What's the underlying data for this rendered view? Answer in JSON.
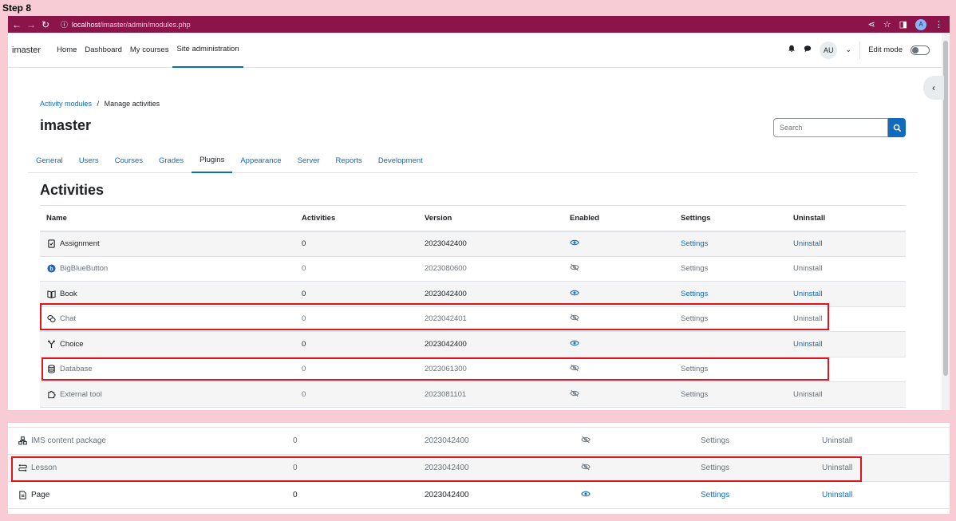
{
  "step_label": "Step 8",
  "browser": {
    "url_host": "localhost",
    "url_path": "/imaster/admin/modules.php",
    "profile_initial": "A"
  },
  "navbar": {
    "brand": "imaster",
    "links": [
      "Home",
      "Dashboard",
      "My courses",
      "Site administration"
    ],
    "user_initials": "AU",
    "edit_mode_label": "Edit mode"
  },
  "breadcrumb": {
    "link": "Activity modules",
    "separator": "/",
    "current": "Manage activities"
  },
  "page_title": "imaster",
  "search": {
    "placeholder": "Search"
  },
  "tabs": [
    "General",
    "Users",
    "Courses",
    "Grades",
    "Plugins",
    "Appearance",
    "Server",
    "Reports",
    "Development"
  ],
  "section_title": "Activities",
  "table": {
    "headers": [
      "Name",
      "Activities",
      "Version",
      "Enabled",
      "Settings",
      "Uninstall"
    ],
    "rows_top": [
      {
        "icon": "assignment-icon",
        "name": "Assignment",
        "activities": "0",
        "version": "2023042400",
        "enabled": true,
        "settings": "Settings",
        "uninstall": "Uninstall"
      },
      {
        "icon": "bigbluebutton-icon",
        "name": "BigBlueButton",
        "activities": "0",
        "version": "2023080600",
        "enabled": false,
        "settings": "Settings",
        "uninstall": "Uninstall"
      },
      {
        "icon": "book-icon",
        "name": "Book",
        "activities": "0",
        "version": "2023042400",
        "enabled": true,
        "settings": "Settings",
        "uninstall": "Uninstall"
      },
      {
        "icon": "chat-icon",
        "name": "Chat",
        "activities": "0",
        "version": "2023042401",
        "enabled": false,
        "settings": "Settings",
        "uninstall": "Uninstall"
      },
      {
        "icon": "choice-icon",
        "name": "Choice",
        "activities": "0",
        "version": "2023042400",
        "enabled": true,
        "settings": "",
        "uninstall": "Uninstall"
      },
      {
        "icon": "database-icon",
        "name": "Database",
        "activities": "0",
        "version": "2023061300",
        "enabled": false,
        "settings": "Settings",
        "uninstall": ""
      },
      {
        "icon": "external-tool-icon",
        "name": "External tool",
        "activities": "0",
        "version": "2023081101",
        "enabled": false,
        "settings": "Settings",
        "uninstall": "Uninstall"
      }
    ],
    "rows_bottom": [
      {
        "icon": "ims-package-icon",
        "name": "IMS content package",
        "activities": "0",
        "version": "2023042400",
        "enabled": false,
        "settings": "Settings",
        "uninstall": "Uninstall"
      },
      {
        "icon": "lesson-icon",
        "name": "Lesson",
        "activities": "0",
        "version": "2023042400",
        "enabled": false,
        "settings": "Settings",
        "uninstall": "Uninstall"
      },
      {
        "icon": "page-icon",
        "name": "Page",
        "activities": "0",
        "version": "2023042400",
        "enabled": true,
        "settings": "Settings",
        "uninstall": "Uninstall"
      }
    ]
  },
  "colors": {
    "browser_bar": "#8b1448",
    "link": "#0f6cbf",
    "highlight": "#e0141e",
    "background": "#f8ccd4"
  }
}
